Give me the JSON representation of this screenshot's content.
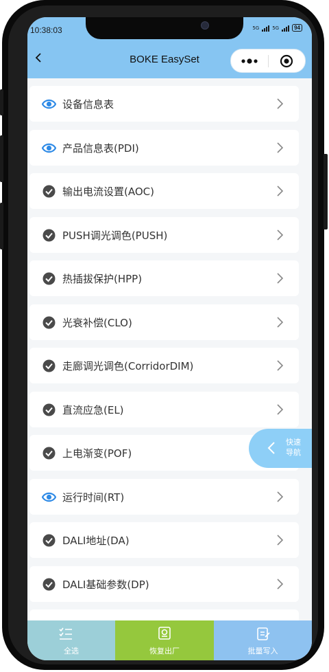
{
  "status_bar": {
    "time": "10:38:03",
    "signal_1": "5G",
    "signal_2": "5G",
    "battery": "94"
  },
  "header": {
    "title": "BOKE EasySet",
    "back_icon": "chevron-left-icon",
    "more_icon": "more-dots-icon",
    "close_icon": "target-circle-icon"
  },
  "colors": {
    "header_bg": "#86c5f2",
    "accent_blue": "#2e8ae6",
    "check_gray": "#4a4a4a",
    "tab_select_all": "#9ccfd8",
    "tab_restore": "#95c83d",
    "tab_batch_write": "#8ec2f0",
    "quicknav_bg": "#8ecff7"
  },
  "menu": [
    {
      "label": "设备信息表",
      "icon": "eye-icon"
    },
    {
      "label": "产品信息表(PDI)",
      "icon": "eye-icon"
    },
    {
      "label": "输出电流设置(AOC)",
      "icon": "check-circle-icon"
    },
    {
      "label": "PUSH调光调色(PUSH)",
      "icon": "check-circle-icon"
    },
    {
      "label": "热插拔保护(HPP)",
      "icon": "check-circle-icon"
    },
    {
      "label": "光衰补偿(CLO)",
      "icon": "check-circle-icon"
    },
    {
      "label": "走廊调光调色(CorridorDIM)",
      "icon": "check-circle-icon"
    },
    {
      "label": "直流应急(EL)",
      "icon": "check-circle-icon"
    },
    {
      "label": "上电渐变(POF)",
      "icon": "check-circle-icon"
    },
    {
      "label": "运行时间(RT)",
      "icon": "eye-icon"
    },
    {
      "label": "DALI地址(DA)",
      "icon": "check-circle-icon"
    },
    {
      "label": "DALI基础参数(DP)",
      "icon": "check-circle-icon"
    }
  ],
  "quick_nav": {
    "line1": "快速",
    "line2": "导航"
  },
  "tabbar": {
    "select_all": {
      "label": "全选",
      "icon": "checklist-icon"
    },
    "restore": {
      "label": "恢复出厂",
      "icon": "factory-reset-icon"
    },
    "batch_write": {
      "label": "批量写入",
      "icon": "edit-document-icon"
    }
  }
}
